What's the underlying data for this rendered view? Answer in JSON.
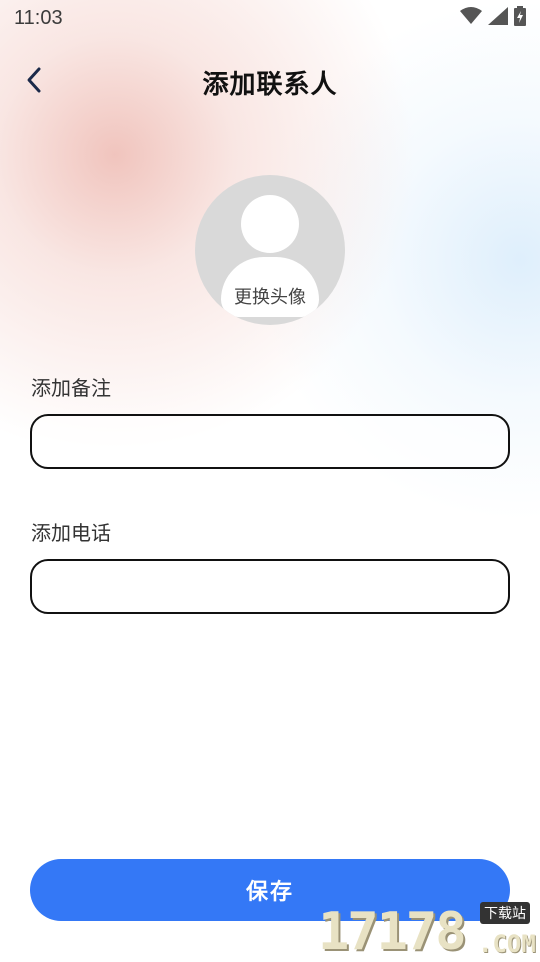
{
  "status_bar": {
    "time": "11:03",
    "icons": [
      "wifi-icon",
      "signal-icon",
      "battery-charging-icon"
    ]
  },
  "header": {
    "back_icon": "chevron-left-icon",
    "title": "添加联系人"
  },
  "avatar": {
    "change_label": "更换头像"
  },
  "form": {
    "remark": {
      "label": "添加备注",
      "value": "",
      "placeholder": ""
    },
    "phone": {
      "label": "添加电话",
      "value": "",
      "placeholder": ""
    }
  },
  "actions": {
    "save_label": "保存"
  },
  "watermark": {
    "digits": "17178",
    "tag": "下载站",
    "domain": ".COM"
  },
  "colors": {
    "accent": "#3478f6",
    "text": "#111111"
  }
}
